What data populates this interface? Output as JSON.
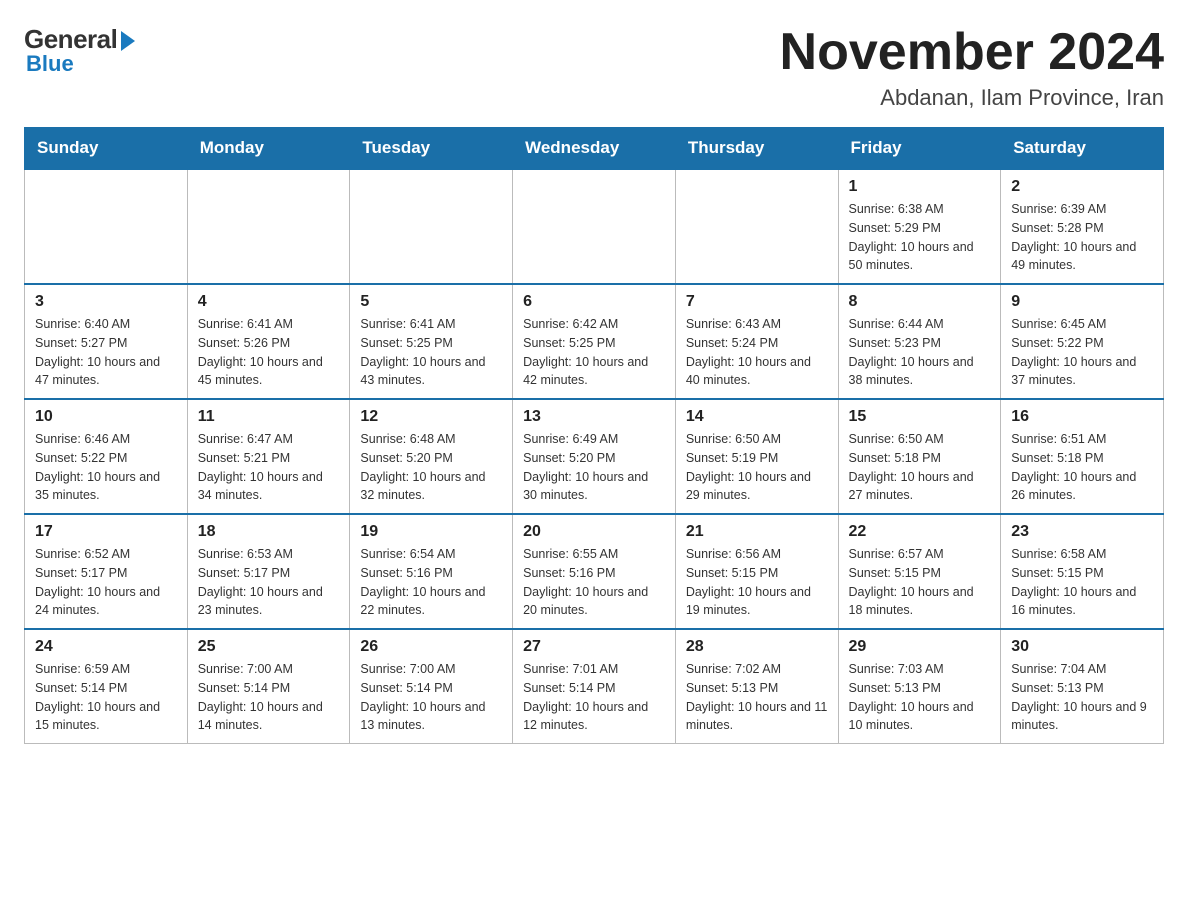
{
  "logo": {
    "general": "General",
    "blue": "Blue"
  },
  "title": {
    "month": "November 2024",
    "location": "Abdanan, Ilam Province, Iran"
  },
  "weekdays": [
    "Sunday",
    "Monday",
    "Tuesday",
    "Wednesday",
    "Thursday",
    "Friday",
    "Saturday"
  ],
  "weeks": [
    [
      {
        "day": "",
        "info": ""
      },
      {
        "day": "",
        "info": ""
      },
      {
        "day": "",
        "info": ""
      },
      {
        "day": "",
        "info": ""
      },
      {
        "day": "",
        "info": ""
      },
      {
        "day": "1",
        "info": "Sunrise: 6:38 AM\nSunset: 5:29 PM\nDaylight: 10 hours and 50 minutes."
      },
      {
        "day": "2",
        "info": "Sunrise: 6:39 AM\nSunset: 5:28 PM\nDaylight: 10 hours and 49 minutes."
      }
    ],
    [
      {
        "day": "3",
        "info": "Sunrise: 6:40 AM\nSunset: 5:27 PM\nDaylight: 10 hours and 47 minutes."
      },
      {
        "day": "4",
        "info": "Sunrise: 6:41 AM\nSunset: 5:26 PM\nDaylight: 10 hours and 45 minutes."
      },
      {
        "day": "5",
        "info": "Sunrise: 6:41 AM\nSunset: 5:25 PM\nDaylight: 10 hours and 43 minutes."
      },
      {
        "day": "6",
        "info": "Sunrise: 6:42 AM\nSunset: 5:25 PM\nDaylight: 10 hours and 42 minutes."
      },
      {
        "day": "7",
        "info": "Sunrise: 6:43 AM\nSunset: 5:24 PM\nDaylight: 10 hours and 40 minutes."
      },
      {
        "day": "8",
        "info": "Sunrise: 6:44 AM\nSunset: 5:23 PM\nDaylight: 10 hours and 38 minutes."
      },
      {
        "day": "9",
        "info": "Sunrise: 6:45 AM\nSunset: 5:22 PM\nDaylight: 10 hours and 37 minutes."
      }
    ],
    [
      {
        "day": "10",
        "info": "Sunrise: 6:46 AM\nSunset: 5:22 PM\nDaylight: 10 hours and 35 minutes."
      },
      {
        "day": "11",
        "info": "Sunrise: 6:47 AM\nSunset: 5:21 PM\nDaylight: 10 hours and 34 minutes."
      },
      {
        "day": "12",
        "info": "Sunrise: 6:48 AM\nSunset: 5:20 PM\nDaylight: 10 hours and 32 minutes."
      },
      {
        "day": "13",
        "info": "Sunrise: 6:49 AM\nSunset: 5:20 PM\nDaylight: 10 hours and 30 minutes."
      },
      {
        "day": "14",
        "info": "Sunrise: 6:50 AM\nSunset: 5:19 PM\nDaylight: 10 hours and 29 minutes."
      },
      {
        "day": "15",
        "info": "Sunrise: 6:50 AM\nSunset: 5:18 PM\nDaylight: 10 hours and 27 minutes."
      },
      {
        "day": "16",
        "info": "Sunrise: 6:51 AM\nSunset: 5:18 PM\nDaylight: 10 hours and 26 minutes."
      }
    ],
    [
      {
        "day": "17",
        "info": "Sunrise: 6:52 AM\nSunset: 5:17 PM\nDaylight: 10 hours and 24 minutes."
      },
      {
        "day": "18",
        "info": "Sunrise: 6:53 AM\nSunset: 5:17 PM\nDaylight: 10 hours and 23 minutes."
      },
      {
        "day": "19",
        "info": "Sunrise: 6:54 AM\nSunset: 5:16 PM\nDaylight: 10 hours and 22 minutes."
      },
      {
        "day": "20",
        "info": "Sunrise: 6:55 AM\nSunset: 5:16 PM\nDaylight: 10 hours and 20 minutes."
      },
      {
        "day": "21",
        "info": "Sunrise: 6:56 AM\nSunset: 5:15 PM\nDaylight: 10 hours and 19 minutes."
      },
      {
        "day": "22",
        "info": "Sunrise: 6:57 AM\nSunset: 5:15 PM\nDaylight: 10 hours and 18 minutes."
      },
      {
        "day": "23",
        "info": "Sunrise: 6:58 AM\nSunset: 5:15 PM\nDaylight: 10 hours and 16 minutes."
      }
    ],
    [
      {
        "day": "24",
        "info": "Sunrise: 6:59 AM\nSunset: 5:14 PM\nDaylight: 10 hours and 15 minutes."
      },
      {
        "day": "25",
        "info": "Sunrise: 7:00 AM\nSunset: 5:14 PM\nDaylight: 10 hours and 14 minutes."
      },
      {
        "day": "26",
        "info": "Sunrise: 7:00 AM\nSunset: 5:14 PM\nDaylight: 10 hours and 13 minutes."
      },
      {
        "day": "27",
        "info": "Sunrise: 7:01 AM\nSunset: 5:14 PM\nDaylight: 10 hours and 12 minutes."
      },
      {
        "day": "28",
        "info": "Sunrise: 7:02 AM\nSunset: 5:13 PM\nDaylight: 10 hours and 11 minutes."
      },
      {
        "day": "29",
        "info": "Sunrise: 7:03 AM\nSunset: 5:13 PM\nDaylight: 10 hours and 10 minutes."
      },
      {
        "day": "30",
        "info": "Sunrise: 7:04 AM\nSunset: 5:13 PM\nDaylight: 10 hours and 9 minutes."
      }
    ]
  ]
}
